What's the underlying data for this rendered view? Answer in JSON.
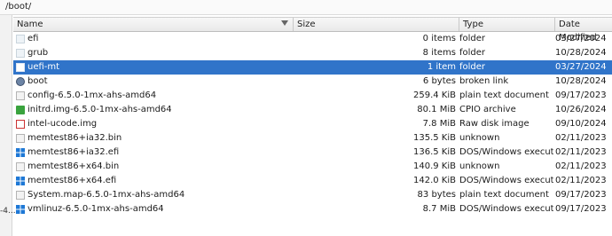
{
  "location": {
    "path": "/boot/"
  },
  "side_fragment": "-4...",
  "columns": {
    "name": "Name",
    "size": "Size",
    "type": "Type",
    "date": "Date Modified"
  },
  "rows": [
    {
      "name": "efi",
      "size": "0 items",
      "type": "folder",
      "date": "03/27/2024",
      "icon": "folder-icon"
    },
    {
      "name": "grub",
      "size": "8 items",
      "type": "folder",
      "date": "10/28/2024",
      "icon": "folder-icon"
    },
    {
      "name": "uefi-mt",
      "size": "1 item",
      "type": "folder",
      "date": "03/27/2024",
      "icon": "folder-icon",
      "selected": true
    },
    {
      "name": "boot",
      "size": "6 bytes",
      "type": "broken link",
      "date": "10/28/2024",
      "icon": "broken-link-icon"
    },
    {
      "name": "config-6.5.0-1mx-ahs-amd64",
      "size": "259.4 KiB",
      "type": "plain text document",
      "date": "09/17/2023",
      "icon": "text-file-icon"
    },
    {
      "name": "initrd.img-6.5.0-1mx-ahs-amd64",
      "size": "80.1 MiB",
      "type": "CPIO archive",
      "date": "10/26/2024",
      "icon": "archive-icon"
    },
    {
      "name": "intel-ucode.img",
      "size": "7.8 MiB",
      "type": "Raw disk image",
      "date": "09/10/2024",
      "icon": "disk-image-icon"
    },
    {
      "name": "memtest86+ia32.bin",
      "size": "135.5 KiB",
      "type": "unknown",
      "date": "02/11/2023",
      "icon": "binary-file-icon"
    },
    {
      "name": "memtest86+ia32.efi",
      "size": "136.5 KiB",
      "type": "DOS/Windows executable",
      "date": "02/11/2023",
      "icon": "windows-executable-icon"
    },
    {
      "name": "memtest86+x64.bin",
      "size": "140.9 KiB",
      "type": "unknown",
      "date": "02/11/2023",
      "icon": "binary-file-icon"
    },
    {
      "name": "memtest86+x64.efi",
      "size": "142.0 KiB",
      "type": "DOS/Windows executable",
      "date": "02/11/2023",
      "icon": "windows-executable-icon"
    },
    {
      "name": "System.map-6.5.0-1mx-ahs-amd64",
      "size": "83 bytes",
      "type": "plain text document",
      "date": "09/17/2023",
      "icon": "text-file-icon"
    },
    {
      "name": "vmlinuz-6.5.0-1mx-ahs-amd64",
      "size": "8.7 MiB",
      "type": "DOS/Windows executable",
      "date": "09/17/2023",
      "icon": "windows-executable-icon"
    }
  ]
}
